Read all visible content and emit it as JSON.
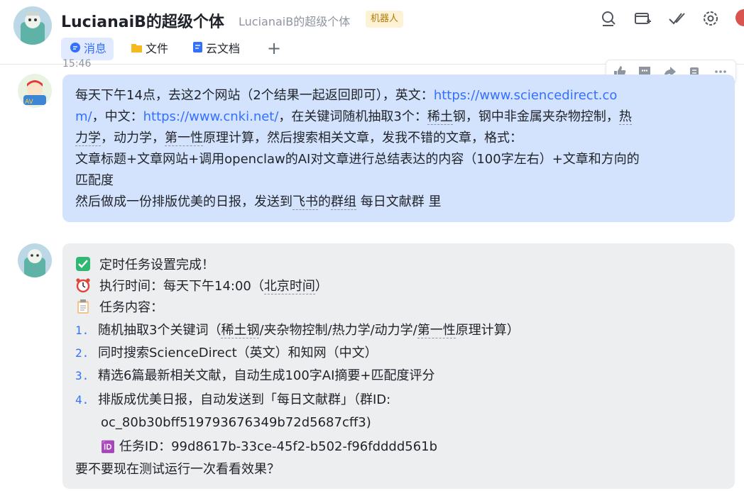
{
  "header": {
    "title": "LucianaiB的超级个体",
    "subtitle": "LucianaiB的超级个体",
    "badge": "机器人",
    "tabs": [
      {
        "label": "消息",
        "active": true
      },
      {
        "label": "文件",
        "active": false
      },
      {
        "label": "云文档",
        "active": false
      }
    ],
    "add_tab": "+"
  },
  "messages": {
    "timestamp": "15:46",
    "user": {
      "p1": "每天下午14点，去这2个网站（2个结果一起返回即可），英文：",
      "link1a": "https://www.sciencedirect.co",
      "link1b": "m/",
      "p2": "，中文：",
      "link2": "https://www.cnki.net/",
      "p3": "，在关键词随机抽取3个：",
      "kw1": "稀土",
      "p4": "钢，钢中非金属夹杂物控制，",
      "kw2": "热",
      "kw2b": "力学",
      "p5": "，动力学，",
      "kw3": "第一性",
      "p6": "原理计算，然后搜索相关文章，发我不错的文章，格式：",
      "line4": "文章标题+文章网站+调用openclaw的AI对文章进行总结表达的内容（100字左右）+文章和方向的",
      "line5": "匹配度",
      "line6a": "然后做成一份排版优美的日报，发送到",
      "line6b": "飞书",
      "line6c": "的",
      "line6d": "群组",
      "line6e": " 每日文献群 里"
    },
    "bot": {
      "done": "定时任务设置完成！",
      "time_label": "执行时间：每天下午14:00（",
      "time_tz": "北京时间",
      "time_end": "）",
      "content_label": "任务内容：",
      "items": [
        {
          "num": "1.",
          "a": "随机抽取3个关键词（",
          "b": "稀土钢",
          "c": "/夹杂物控制/热力学/动力学/",
          "d": "第一性",
          "e": "原理计算）"
        },
        {
          "num": "2.",
          "text": "同时搜索ScienceDirect（英文）和知网（中文）"
        },
        {
          "num": "3.",
          "text": "精选6篇最新相关文献，自动生成100字AI摘要+匹配度评分"
        },
        {
          "num": "4.",
          "text": "排版成优美日报，自动发送到「每日文献群」（群ID:",
          "cont": "oc_80b30bff519793676349b72d5687cff3)"
        }
      ],
      "task_id": "任务ID：99d8617b-33ce-45f2-b502-f96fdddd561b",
      "id_glyph": "🆔",
      "question": "要不要现在测试运行一次看看效果？"
    }
  },
  "colors": {
    "accent": "#3370ff",
    "user_bubble": "#d4e3fd",
    "bot_bubble": "#eceef0",
    "badge_bg": "#fdf3d4",
    "badge_text": "#b07a0b"
  },
  "icons": [
    "search-icon",
    "add-window-icon",
    "check-mark-icon",
    "settings-icon",
    "thumbs-up-icon",
    "comment-icon",
    "forward-icon",
    "pin-icon",
    "more-icon",
    "check-box-icon",
    "alarm-clock-icon",
    "clipboard-icon",
    "folder-icon",
    "doc-icon",
    "chat-icon"
  ]
}
